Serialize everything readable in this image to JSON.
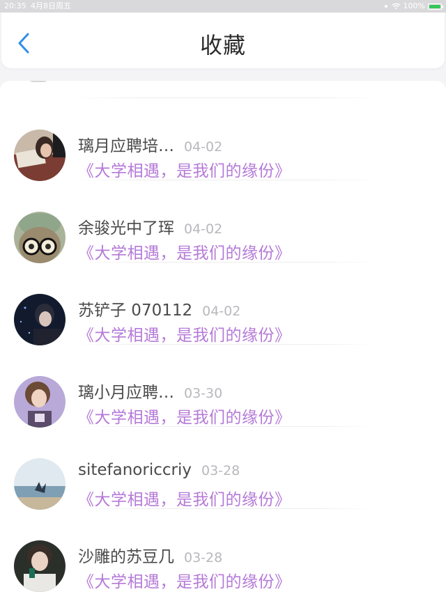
{
  "status_bar": {
    "time": "20:35",
    "date": "4月8日周五",
    "battery_percent": "100%",
    "battery_color": "#34c759"
  },
  "header": {
    "title": "收藏",
    "back_icon": "chevron-left-icon",
    "accent": "#2f8ee9"
  },
  "favorites": [
    {
      "name": "璃月应聘培…",
      "date": "04-02",
      "subtitle": "《大学相遇，是我们的缘份》"
    },
    {
      "name": "余骏光中了珲",
      "date": "04-02",
      "subtitle": "《大学相遇，是我们的缘份》"
    },
    {
      "name": "苏铲子 070112",
      "date": "04-02",
      "subtitle": "《大学相遇，是我们的缘份》"
    },
    {
      "name": "璃小月应聘…",
      "date": "03-30",
      "subtitle": "《大学相遇，是我们的缘份》"
    },
    {
      "name": "sitefanoriccriy",
      "date": "03-28",
      "subtitle": "《大学相遇，是我们的缘份》"
    },
    {
      "name": "沙雕的苏豆几",
      "date": "03-28",
      "subtitle": "《大学相遇，是我们的缘份》"
    }
  ],
  "colors": {
    "subtitle": "#b57ad8",
    "name": "#4a4a4a",
    "date": "#b8b8bd"
  }
}
